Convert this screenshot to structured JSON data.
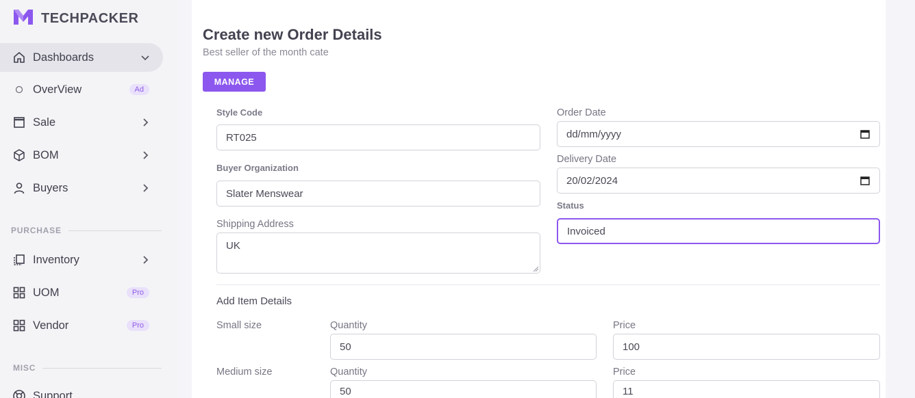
{
  "brand": {
    "name": "TECHPACKER"
  },
  "sidebar": {
    "items": [
      {
        "label": "Dashboards",
        "icon": "home-icon",
        "active": true,
        "chevron": "down"
      },
      {
        "label": "OverView",
        "icon": "circle-icon",
        "badge": "Ad"
      },
      {
        "label": "Sale",
        "icon": "window-icon",
        "chevron": "right"
      },
      {
        "label": "BOM",
        "icon": "box-icon",
        "chevron": "right"
      },
      {
        "label": "Buyers",
        "icon": "user-icon",
        "chevron": "right"
      }
    ],
    "section_purchase": "PURCHASE",
    "purchase_items": [
      {
        "label": "Inventory",
        "icon": "copy-icon",
        "chevron": "right"
      },
      {
        "label": "UOM",
        "icon": "grid-icon",
        "badge": "Pro"
      },
      {
        "label": "Vendor",
        "icon": "grid-icon",
        "badge": "Pro"
      }
    ],
    "section_misc": "MISC",
    "misc_items": [
      {
        "label": "Support",
        "icon": "lifebuoy-icon"
      }
    ]
  },
  "main": {
    "title": "Create new Order Details",
    "subtitle": "Best seller of the month cate",
    "manage_label": "MANAGE",
    "form": {
      "style_code_label": "Style Code",
      "style_code_value": "RT025",
      "buyer_org_label": "Buyer Organization",
      "buyer_org_value": "Slater Menswear",
      "shipping_label": "Shipping Address",
      "shipping_value": "UK",
      "order_date_label": "Order Date",
      "order_date_value": "dd/mm/yyyy",
      "delivery_date_label": "Delivery Date",
      "delivery_date_value": "20/02/2024",
      "status_label": "Status",
      "status_value": "Invoiced"
    },
    "items_title": "Add Item Details",
    "items": [
      {
        "size": "Small size",
        "qty_label": "Quantity",
        "qty": "50",
        "price_label": "Price",
        "price": "100"
      },
      {
        "size": "Medium size",
        "qty_label": "Quantity",
        "qty": "50",
        "price_label": "Price",
        "price": "11"
      }
    ]
  },
  "colors": {
    "accent": "#8c57ee",
    "badge_bg": "#e9e0fb"
  }
}
